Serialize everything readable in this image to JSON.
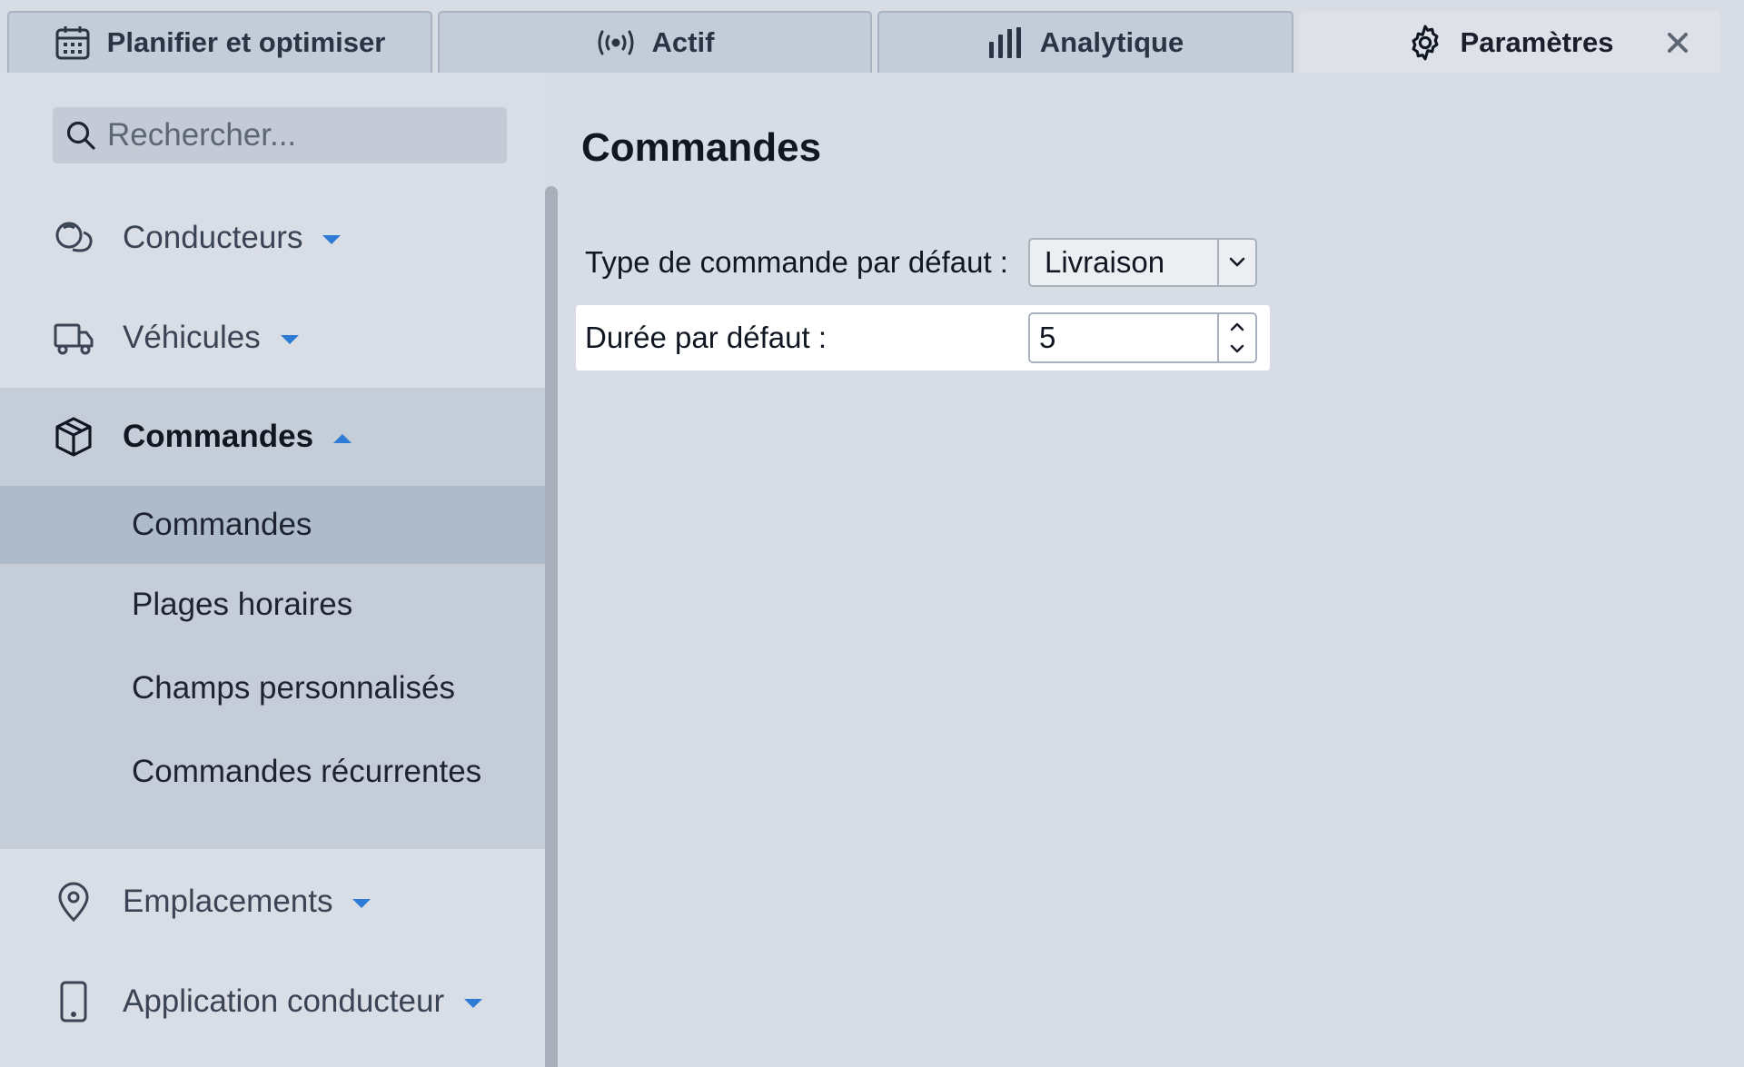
{
  "tabs": [
    {
      "label": "Planifier et optimiser",
      "icon": "calendar-icon"
    },
    {
      "label": "Actif",
      "icon": "broadcast-icon"
    },
    {
      "label": "Analytique",
      "icon": "bar-chart-icon"
    },
    {
      "label": "Paramètres",
      "icon": "gear-icon",
      "active": true
    }
  ],
  "search": {
    "placeholder": "Rechercher..."
  },
  "sidebar": {
    "items": [
      {
        "label": "Conducteurs",
        "icon": "drivers-icon",
        "expanded": false
      },
      {
        "label": "Véhicules",
        "icon": "truck-icon",
        "expanded": false
      },
      {
        "label": "Commandes",
        "icon": "package-icon",
        "expanded": true,
        "children": [
          {
            "label": "Commandes",
            "selected": true
          },
          {
            "label": "Plages horaires"
          },
          {
            "label": "Champs personnalisés"
          },
          {
            "label": "Commandes récurrentes"
          }
        ]
      },
      {
        "label": "Emplacements",
        "icon": "location-pin-icon",
        "expanded": false
      },
      {
        "label": "Application conducteur",
        "icon": "phone-icon",
        "expanded": false
      }
    ]
  },
  "main": {
    "title": "Commandes",
    "fields": {
      "order_type": {
        "label": "Type de commande par défaut :",
        "value": "Livraison"
      },
      "duration": {
        "label": "Durée par défaut :",
        "value": "5"
      }
    }
  },
  "colors": {
    "accent": "#2e7bd6",
    "selected_row": "#aebbca",
    "expanded_group": "#c5cdd8"
  }
}
